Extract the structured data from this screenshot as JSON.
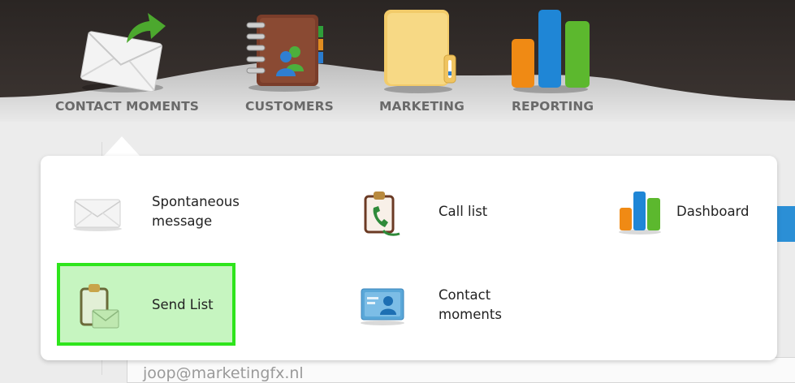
{
  "nav": {
    "items": [
      {
        "label": "CONTACT MOMENTS",
        "icon": "envelope-arrow-icon"
      },
      {
        "label": "CUSTOMERS",
        "icon": "address-book-icon"
      },
      {
        "label": "MARKETING",
        "icon": "folder-icon"
      },
      {
        "label": "REPORTING",
        "icon": "bar-chart-icon"
      }
    ]
  },
  "dropdown": {
    "items": [
      {
        "label_line1": "Spontaneous",
        "label_line2": "message",
        "icon": "envelope-icon"
      },
      {
        "label": "Call list",
        "icon": "clipboard-phone-icon"
      },
      {
        "label": "Dashboard",
        "icon": "dashboard-chart-icon"
      },
      {
        "label": "Send List",
        "icon": "clipboard-envelope-icon",
        "highlighted": true
      },
      {
        "label_line1": "Contact",
        "label_line2": "moments",
        "icon": "contact-card-icon"
      }
    ]
  },
  "background": {
    "email_value": "joop@marketingfx.nl"
  },
  "colors": {
    "header_dark": "#2a2523",
    "highlight_fill": "#c6f5c0",
    "highlight_border": "#2ee51c",
    "accent_blue": "#2b8fd6"
  }
}
